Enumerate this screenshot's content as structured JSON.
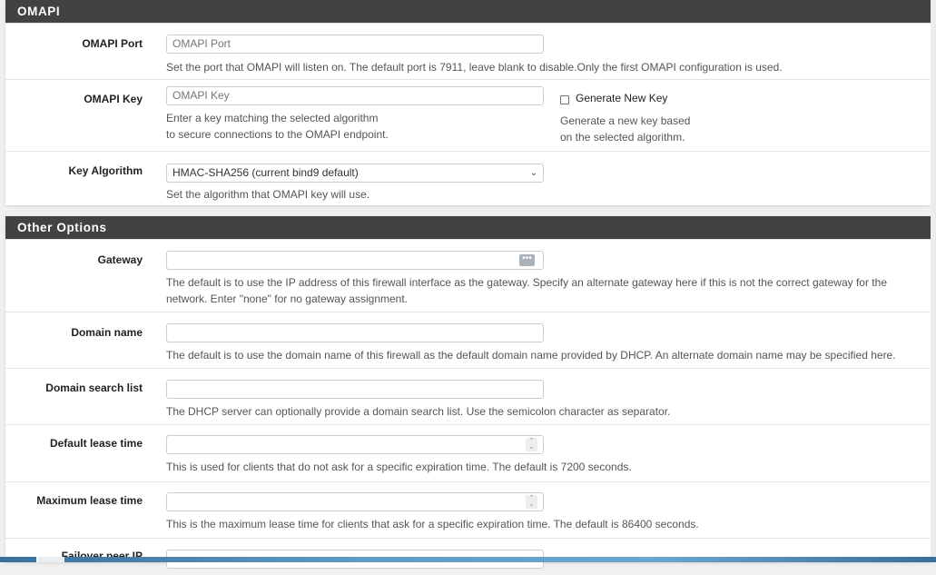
{
  "omapi": {
    "heading": "OMAPI",
    "port": {
      "label": "OMAPI Port",
      "placeholder": "OMAPI Port",
      "value": "",
      "help": "Set the port that OMAPI will listen on. The default port is 7911, leave blank to disable.Only the first OMAPI configuration is used."
    },
    "key": {
      "label": "OMAPI Key",
      "placeholder": "OMAPI Key",
      "value": "",
      "help_line1": "Enter a key matching the selected algorithm",
      "help_line2": "to secure connections to the OMAPI endpoint.",
      "generate_label": "Generate New Key",
      "generate_checked": false,
      "generate_help_line1": "Generate a new key based",
      "generate_help_line2": "on the selected algorithm."
    },
    "algorithm": {
      "label": "Key Algorithm",
      "selected": "HMAC-SHA256 (current bind9 default)",
      "help": "Set the algorithm that OMAPI key will use."
    }
  },
  "other": {
    "heading": "Other Options",
    "gateway": {
      "label": "Gateway",
      "value": "",
      "help_line1": "The default is to use the IP address of this firewall interface as the gateway. Specify an alternate gateway here if this is not the correct gateway for the",
      "help_line2": "network. Enter \"none\" for no gateway assignment."
    },
    "domain_name": {
      "label": "Domain name",
      "value": "",
      "help": "The default is to use the domain name of this firewall as the default domain name provided by DHCP. An alternate domain name may be specified here."
    },
    "domain_search": {
      "label": "Domain search list",
      "value": "",
      "help": "The DHCP server can optionally provide a domain search list. Use the semicolon character as separator."
    },
    "default_lease": {
      "label": "Default lease time",
      "value": "",
      "help": "This is used for clients that do not ask for a specific expiration time. The default is 7200 seconds."
    },
    "max_lease": {
      "label": "Maximum lease time",
      "value": "",
      "help": "This is the maximum lease time for clients that ask for a specific expiration time. The default is 86400 seconds."
    },
    "failover": {
      "label": "Failover peer IP",
      "value": ""
    }
  },
  "icons": {
    "select_arrow": "⌄",
    "dots": "•••",
    "spinner_up": "⌃",
    "spinner_down": "⌄"
  }
}
